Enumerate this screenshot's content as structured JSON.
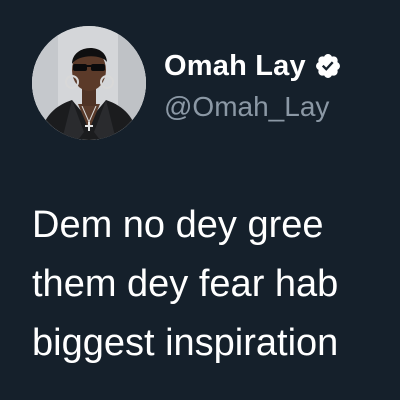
{
  "author": {
    "display_name": "Omah Lay",
    "handle": "@Omah_Lay",
    "verified": true
  },
  "tweet": {
    "lines": [
      "Dem no dey gree",
      "them dey fear hab",
      "biggest inspiration"
    ]
  },
  "icons": {
    "verified": "verified-badge-icon",
    "avatar": "profile-photo"
  },
  "colors": {
    "background": "#15202b",
    "text_primary": "#ffffff",
    "text_secondary": "#8b98a5"
  }
}
